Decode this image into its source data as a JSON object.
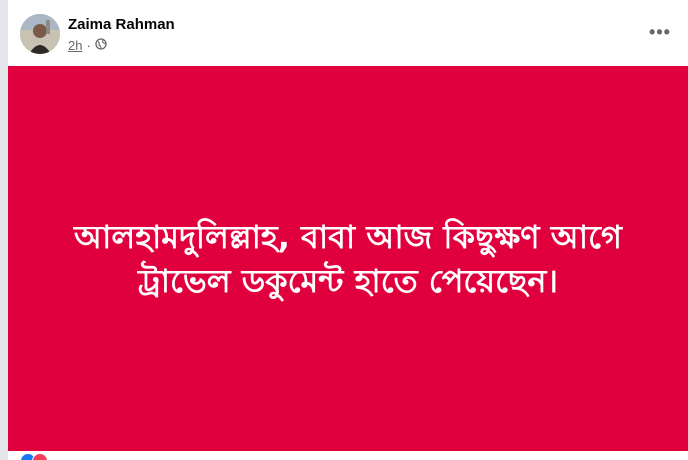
{
  "post": {
    "author": "Zaima Rahman",
    "time": "2h",
    "separator": "·",
    "menu_label": "•••",
    "text_line1": "আলহামদুলিল্লাহ, বাবা আজ কিছুক্ষণ আগে",
    "text_line2": "ট্রাভেল ডকুমেন্ট হাতে পেয়েছেন।",
    "background_color": "#e1003e"
  },
  "reactions": {
    "colors": [
      "#1877f2",
      "#f33e58"
    ]
  }
}
